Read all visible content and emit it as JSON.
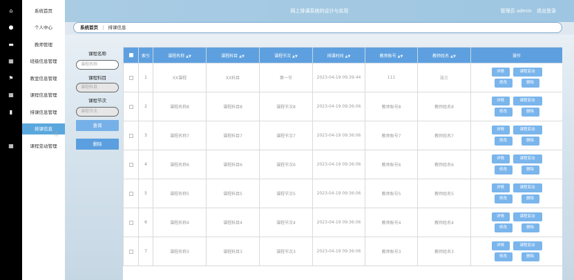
{
  "header": {
    "title": "网上排课系统的设计与实现",
    "user_label": "管理员 admin",
    "logout_label": "退出登录"
  },
  "sidebar": {
    "items": [
      {
        "label": "系统首页"
      },
      {
        "label": "个人中心"
      },
      {
        "label": "教师管理"
      },
      {
        "label": "班级信息管理"
      },
      {
        "label": "教室信息管理"
      },
      {
        "label": "课程信息管理"
      },
      {
        "label": "排课信息管理"
      },
      {
        "label": "排课信息"
      },
      {
        "label": "课程变动管理"
      }
    ]
  },
  "breadcrumb": {
    "home": "系统首页",
    "separator": "⋮",
    "current": "排课信息"
  },
  "search": {
    "course_name_label": "课程名称",
    "course_name_placeholder": "课程名称",
    "course_subject_label": "课程科目",
    "course_subject_placeholder": "课程科目",
    "course_section_label": "课程节次",
    "course_section_placeholder": "课程节次",
    "query_button": "查询",
    "delete_button": "删除"
  },
  "table": {
    "headers": [
      "索引",
      "课程名称",
      "课程科目",
      "课程节次",
      "排课时间",
      "教师账号",
      "教师姓名",
      "操作"
    ],
    "ops": {
      "detail": "详情",
      "change": "课程变动",
      "edit": "修改",
      "delete": "删除"
    },
    "rows": [
      {
        "index": "1",
        "name": "XX课程",
        "subject": "XX科目",
        "section": "第一节",
        "time": "2023-04-19 09:39:44",
        "account": "111",
        "teacher": "张三"
      },
      {
        "index": "2",
        "name": "课程名称8",
        "subject": "课程科目8",
        "section": "课程节次8",
        "time": "2023-04-19 09:36:06",
        "account": "教师账号8",
        "teacher": "教师姓名8"
      },
      {
        "index": "3",
        "name": "课程名称7",
        "subject": "课程科目7",
        "section": "课程节次7",
        "time": "2023-04-19 09:36:06",
        "account": "教师账号7",
        "teacher": "教师姓名7"
      },
      {
        "index": "4",
        "name": "课程名称6",
        "subject": "课程科目6",
        "section": "课程节次6",
        "time": "2023-04-19 09:36:06",
        "account": "教师账号6",
        "teacher": "教师姓名6"
      },
      {
        "index": "5",
        "name": "课程名称5",
        "subject": "课程科目5",
        "section": "课程节次5",
        "time": "2023-04-19 09:36:06",
        "account": "教师账号5",
        "teacher": "教师姓名5"
      },
      {
        "index": "6",
        "name": "课程名称4",
        "subject": "课程科目4",
        "section": "课程节次4",
        "time": "2023-04-19 09:36:06",
        "account": "教师账号4",
        "teacher": "教师姓名4"
      },
      {
        "index": "7",
        "name": "课程名称3",
        "subject": "课程科目3",
        "section": "课程节次3",
        "time": "2023-04-19 09:36:06",
        "account": "教师账号3",
        "teacher": "教师姓名3"
      }
    ]
  },
  "colors": {
    "accent": "#5ea0df",
    "header_bg": "#a9cce3",
    "button": "#7ab5ec",
    "active_nav": "#5aa7dd"
  }
}
